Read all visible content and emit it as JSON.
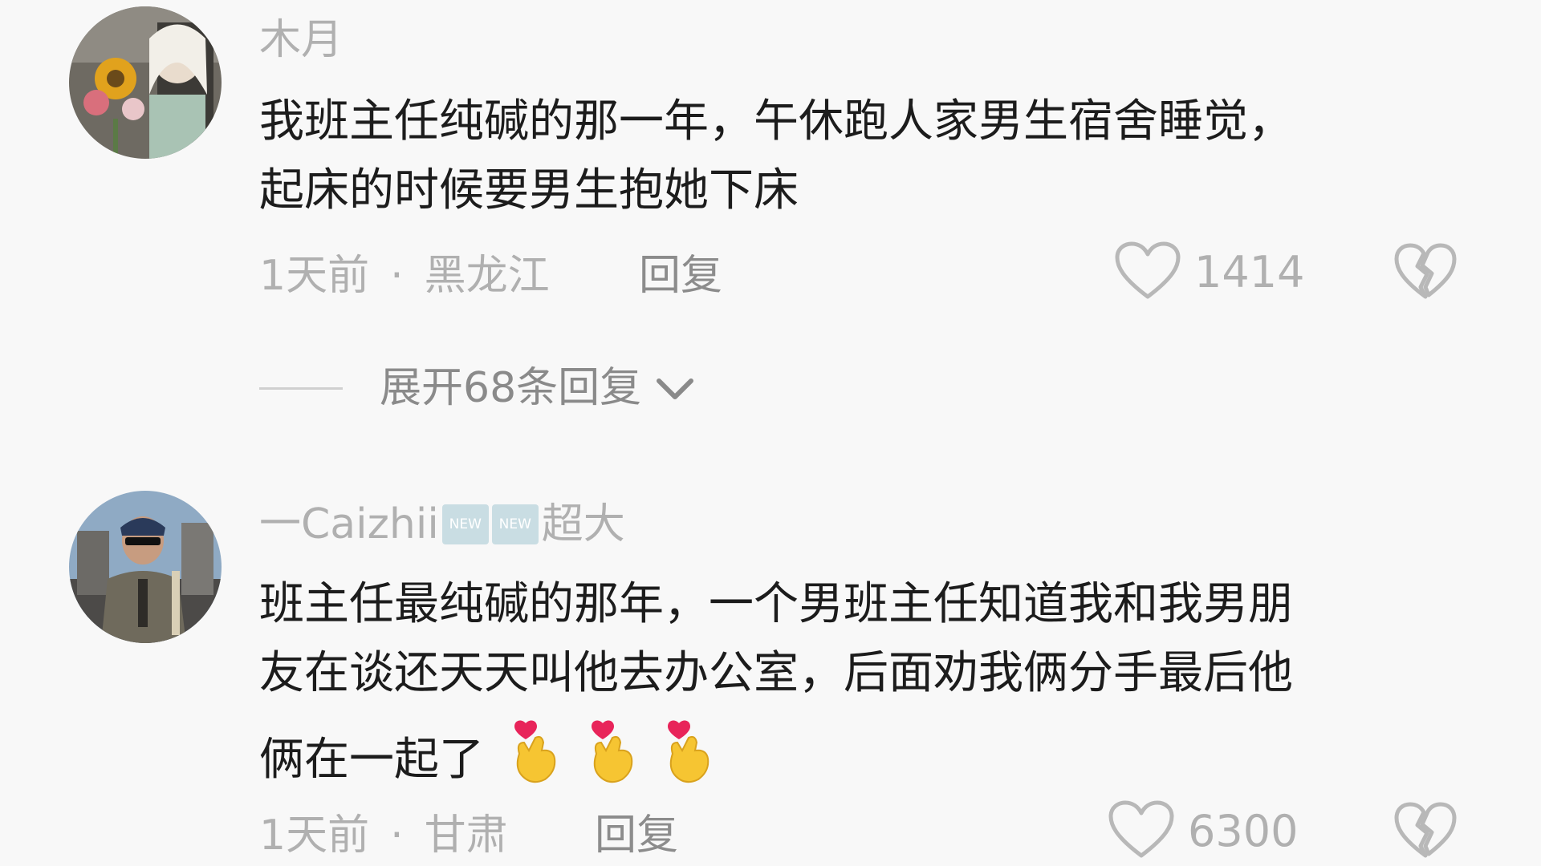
{
  "comments": [
    {
      "username": "木月",
      "badges": [],
      "text_lines": [
        "我班主任纯碱的那一年，午休跑人家男生宿舍睡觉，",
        "起床的时候要男生抱她下床"
      ],
      "time": "1天前",
      "dot": "·",
      "location": "黑龙江",
      "reply_label": "回复",
      "likes": "1414",
      "expand_label": "展开68条回复"
    },
    {
      "username": "一Caizhii",
      "badges": [
        "NEW",
        "NEW"
      ],
      "badge_tail": "超大",
      "text_lines": [
        "班主任最纯碱的那年，一个男班主任知道我和我男朋",
        "友在谈还天天叫他去办公室，后面劝我俩分手最后他",
        "俩在一起了"
      ],
      "time": "1天前",
      "dot": "·",
      "location": "甘肃",
      "reply_label": "回复",
      "likes": "6300"
    }
  ],
  "icons": {
    "like": "heart-outline-icon",
    "dislike": "broken-heart-icon",
    "expand": "chevron-down-icon",
    "emoji": "finger-heart-emoji-icon"
  },
  "colors": {
    "background": "#f8f8f8",
    "text": "#1c1c1c",
    "meta": "#b0b0b0",
    "reply": "#8c8c8c"
  }
}
